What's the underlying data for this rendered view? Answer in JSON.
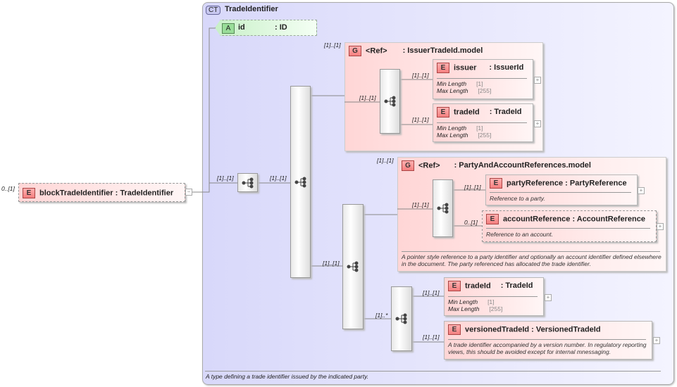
{
  "root": {
    "occurs": "0..[1]",
    "badge": "E",
    "name": "blockTradeIdentifier",
    "type": ": TradeIdentifier"
  },
  "complex_type": {
    "badge": "CT",
    "name": "TradeIdentifier",
    "annotation": "A type defining a trade identifier issued by the indicated party."
  },
  "attribute": {
    "badge": "A",
    "name": "id",
    "type": ": ID"
  },
  "occurs": {
    "seq1": "[1]..[1]",
    "seq_tall": "[1]..[1]",
    "group1": "[1]..[1]",
    "group1_inner": "[1]..[1]",
    "group2": "[1]..[1]",
    "group2_inner": "[1]..[1]",
    "party_seq": "[1]..[1]",
    "choice_seq": "[1]..*",
    "issuer": "[1]..[1]",
    "tradeId1": "[1]..[1]",
    "partyReference": "[1]..[1]",
    "accountReference": "0..[1]",
    "tradeId2": "[1]..[1]",
    "versionedTradeId": "[1]..[1]"
  },
  "group1": {
    "badge": "G",
    "ref": "<Ref>",
    "type": ": IssuerTradeId.model",
    "issuer": {
      "badge": "E",
      "name": "issuer",
      "type": ": IssuerId",
      "min_label": "Min Length",
      "min": "[1]",
      "max_label": "Max Length",
      "max": "[255]"
    },
    "tradeId": {
      "badge": "E",
      "name": "tradeId",
      "type": ": TradeId",
      "min_label": "Min Length",
      "min": "[1]",
      "max_label": "Max Length",
      "max": "[255]"
    }
  },
  "group2": {
    "badge": "G",
    "ref": "<Ref>",
    "type": ": PartyAndAccountReferences.model",
    "partyReference": {
      "badge": "E",
      "name": "partyReference",
      "type": ": PartyReference",
      "desc": "Reference to a party."
    },
    "accountReference": {
      "badge": "E",
      "name": "accountReference",
      "type": ": AccountReference",
      "desc": "Reference to an account."
    },
    "desc": "A pointer style reference to a party identifier and optionally an account identifier defined elsewhere in the document. The party referenced has allocated the trade identifier."
  },
  "tradeId2": {
    "badge": "E",
    "name": "tradeId",
    "type": ": TradeId",
    "min_label": "Min Length",
    "min": "[1]",
    "max_label": "Max Length",
    "max": "[255]"
  },
  "versionedTradeId": {
    "badge": "E",
    "name": "versionedTradeId",
    "type": ": VersionedTradeId",
    "desc": "A trade identifier accompanied by a version number. In regulatory reporting views, this should be avoided except for internal mnessaging."
  },
  "expand_symbol": "+",
  "collapse_symbol": "−"
}
